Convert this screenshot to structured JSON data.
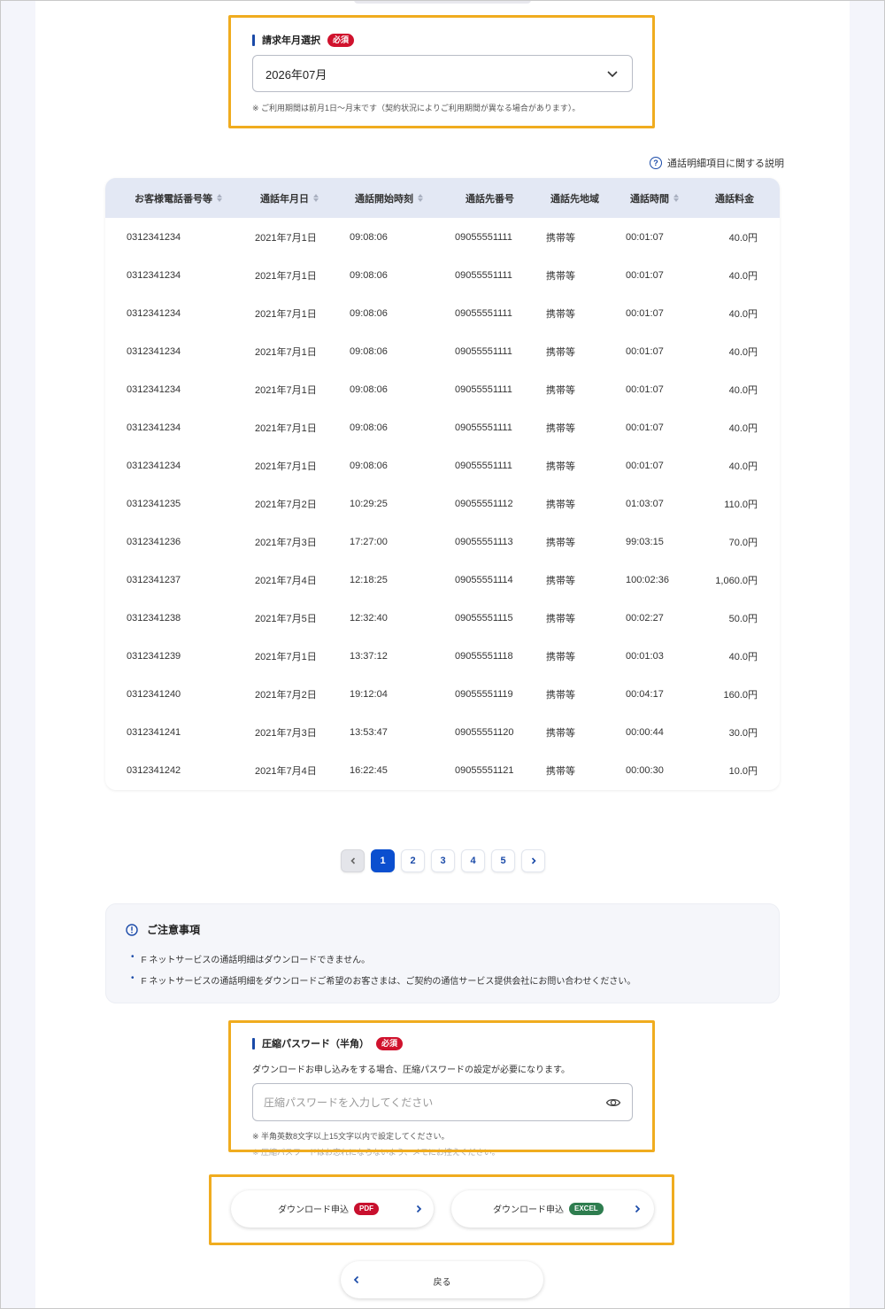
{
  "billing": {
    "label": "請求年月選択",
    "required": "必須",
    "selected": "2026年07月",
    "note": "※ ご利用期間は前月1日～月末です（契約状況によりご利用期間が異なる場合があります）。"
  },
  "help_link": "通話明細項目に関する説明",
  "table": {
    "headers": [
      "お客様電話番号等",
      "通話年月日",
      "通話開始時刻",
      "通話先番号",
      "通話先地域",
      "通話時間",
      "通話料金"
    ],
    "rows": [
      [
        "0312341234",
        "2021年7月1日",
        "09:08:06",
        "09055551111",
        "携帯等",
        "00:01:07",
        "40.0円"
      ],
      [
        "0312341234",
        "2021年7月1日",
        "09:08:06",
        "09055551111",
        "携帯等",
        "00:01:07",
        "40.0円"
      ],
      [
        "0312341234",
        "2021年7月1日",
        "09:08:06",
        "09055551111",
        "携帯等",
        "00:01:07",
        "40.0円"
      ],
      [
        "0312341234",
        "2021年7月1日",
        "09:08:06",
        "09055551111",
        "携帯等",
        "00:01:07",
        "40.0円"
      ],
      [
        "0312341234",
        "2021年7月1日",
        "09:08:06",
        "09055551111",
        "携帯等",
        "00:01:07",
        "40.0円"
      ],
      [
        "0312341234",
        "2021年7月1日",
        "09:08:06",
        "09055551111",
        "携帯等",
        "00:01:07",
        "40.0円"
      ],
      [
        "0312341234",
        "2021年7月1日",
        "09:08:06",
        "09055551111",
        "携帯等",
        "00:01:07",
        "40.0円"
      ],
      [
        "0312341235",
        "2021年7月2日",
        "10:29:25",
        "09055551112",
        "携帯等",
        "01:03:07",
        "110.0円"
      ],
      [
        "0312341236",
        "2021年7月3日",
        "17:27:00",
        "09055551113",
        "携帯等",
        "99:03:15",
        "70.0円"
      ],
      [
        "0312341237",
        "2021年7月4日",
        "12:18:25",
        "09055551114",
        "携帯等",
        "100:02:36",
        "1,060.0円"
      ],
      [
        "0312341238",
        "2021年7月5日",
        "12:32:40",
        "09055551115",
        "携帯等",
        "00:02:27",
        "50.0円"
      ],
      [
        "0312341239",
        "2021年7月1日",
        "13:37:12",
        "09055551118",
        "携帯等",
        "00:01:03",
        "40.0円"
      ],
      [
        "0312341240",
        "2021年7月2日",
        "19:12:04",
        "09055551119",
        "携帯等",
        "00:04:17",
        "160.0円"
      ],
      [
        "0312341241",
        "2021年7月3日",
        "13:53:47",
        "09055551120",
        "携帯等",
        "00:00:44",
        "30.0円"
      ],
      [
        "0312341242",
        "2021年7月4日",
        "16:22:45",
        "09055551121",
        "携帯等",
        "00:00:30",
        "10.0円"
      ]
    ]
  },
  "pagination": {
    "pages": [
      "1",
      "2",
      "3",
      "4",
      "5"
    ],
    "current": "1"
  },
  "notice": {
    "title": "ご注意事項",
    "items": [
      "F ネットサービスの通話明細はダウンロードできません。",
      "F ネットサービスの通話明細をダウンロードご希望のお客さまは、ご契約の通信サービス提供会社にお問い合わせください。"
    ]
  },
  "password": {
    "label": "圧縮パスワード（半角）",
    "required": "必須",
    "description": "ダウンロードお申し込みをする場合、圧縮パスワードの設定が必要になります。",
    "placeholder": "圧縮パスワードを入力してください",
    "value": "",
    "note": "※ 半角英数8文字以上15文字以内で設定してください。",
    "note2": "※ 圧縮パスワードはお忘れにならないよう、メモにお控えください。"
  },
  "buttons": {
    "download_label": "ダウンロード申込",
    "pdf_tag": "PDF",
    "excel_tag": "EXCEL",
    "back": "戻る"
  },
  "colors": {
    "accent": "#0b4fcf",
    "highlight": "#f0ac1f",
    "required": "#d0122d",
    "excel": "#2e7d4f"
  }
}
